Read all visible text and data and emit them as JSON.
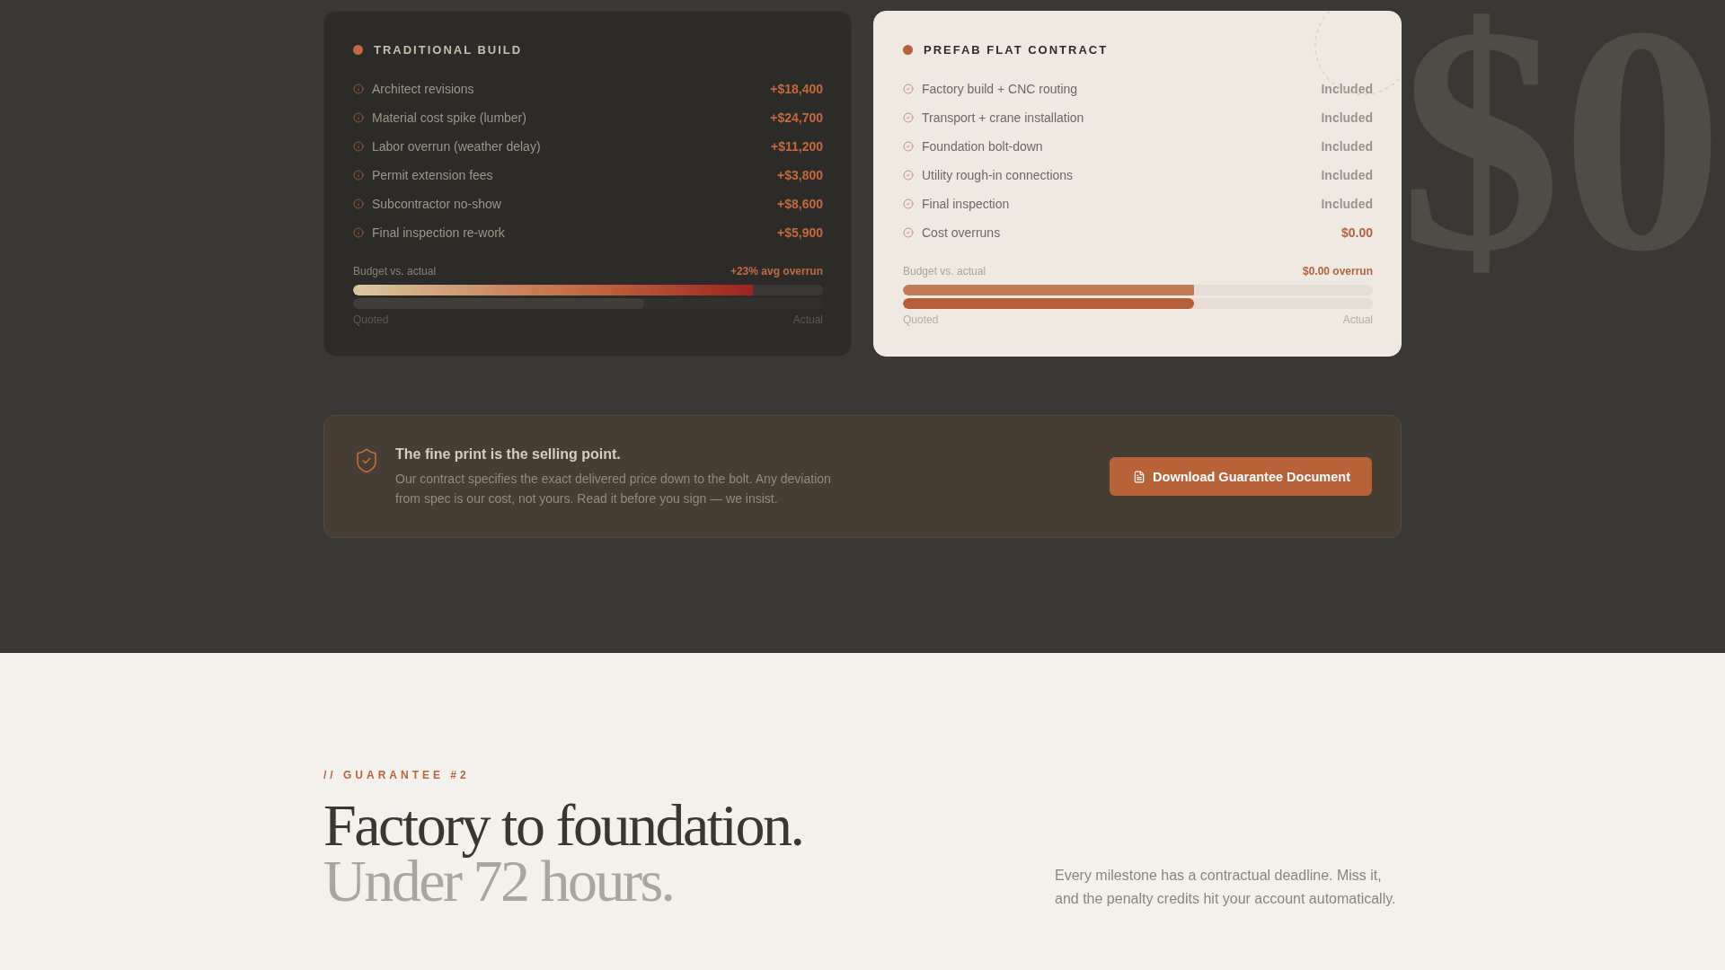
{
  "comparison": {
    "cards": [
      {
        "kind": "traditional",
        "title": "TRADITIONAL BUILD",
        "items": [
          {
            "label": "Architect revisions",
            "value": "+$18,400",
            "kind": "overrun"
          },
          {
            "label": "Material cost spike (lumber)",
            "value": "+$24,700",
            "kind": "overrun"
          },
          {
            "label": "Labor overrun (weather delay)",
            "value": "+$11,200",
            "kind": "overrun"
          },
          {
            "label": "Permit extension fees",
            "value": "+$3,800",
            "kind": "overrun"
          },
          {
            "label": "Subcontractor no-show",
            "value": "+$8,600",
            "kind": "overrun"
          },
          {
            "label": "Final inspection re-work",
            "value": "+$5,900",
            "kind": "overrun"
          }
        ],
        "budget": {
          "label": "Budget vs. actual",
          "summary": "+23% avg overrun",
          "bars": [
            {
              "level": 0.85
            },
            {
              "level": 0.62
            }
          ],
          "start_label": "Quoted",
          "end_label": "Actual"
        }
      },
      {
        "kind": "prefab",
        "title": "PREFAB FLAT CONTRACT",
        "items": [
          {
            "label": "Factory build + CNC routing",
            "value": "Included",
            "kind": "included"
          },
          {
            "label": "Transport + crane installation",
            "value": "Included",
            "kind": "included"
          },
          {
            "label": "Foundation bolt-down",
            "value": "Included",
            "kind": "included"
          },
          {
            "label": "Utility rough-in connections",
            "value": "Included",
            "kind": "included"
          },
          {
            "label": "Final inspection",
            "value": "Included",
            "kind": "included"
          },
          {
            "label": "Cost overruns",
            "value": "$0.00",
            "kind": "zero"
          }
        ],
        "budget": {
          "label": "Budget vs. actual",
          "summary": "$0.00 overrun",
          "bars": [
            {
              "level": 0.62
            },
            {
              "level": 0.62
            }
          ],
          "start_label": "Quoted",
          "end_label": "Actual"
        }
      }
    ]
  },
  "backdrop_figure": "$0",
  "guarantee_banner": {
    "title": "The fine print is the selling point.",
    "body": "Our contract specifies the exact delivered price down to the bolt. Any deviation from spec is our cost, not yours. Read it before you sign — we insist.",
    "button": {
      "label": "Download Guarantee Document"
    }
  },
  "section": {
    "eyebrow": "// GUARANTEE #2",
    "headline": "Factory to foundation.",
    "headline_muted": "Under 72 hours.",
    "description": "Every milestone has a contractual deadline. Miss it, and the penalty credits hit your account automatically."
  }
}
